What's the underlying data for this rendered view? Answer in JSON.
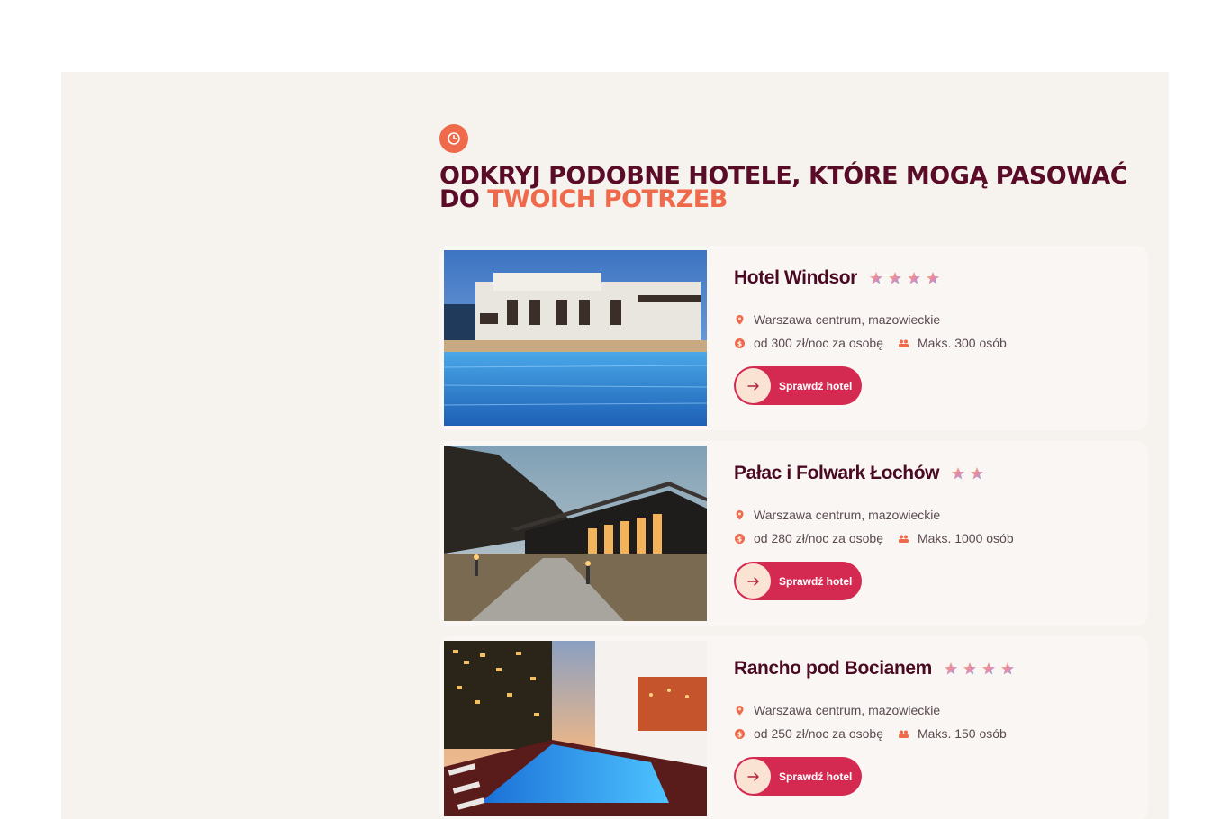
{
  "section": {
    "heading_main": "ODKRYJ PODOBNE HOTELE, KTÓRE MOGĄ PASOWAĆ DO ",
    "heading_accent": "TWOICH POTRZEB"
  },
  "colors": {
    "accent": "#ef6a4b",
    "heading": "#5a0b27",
    "button": "#d42a52",
    "background": "#f6f2ee"
  },
  "hotels": [
    {
      "name": "Hotel Windsor",
      "stars": 4,
      "location": "Warszawa centrum, mazowieckie",
      "price": "od 300 zł/noc za osobę",
      "capacity": "Maks. 300 osób",
      "button_label": "Sprawdź hotel"
    },
    {
      "name": "Pałac i Folwark Łochów",
      "stars": 2,
      "location": "Warszawa centrum, mazowieckie",
      "price": "od 280 zł/noc za osobę",
      "capacity": "Maks. 1000 osób",
      "button_label": "Sprawdź hotel"
    },
    {
      "name": "Rancho pod Bocianem",
      "stars": 4,
      "location": "Warszawa centrum, mazowieckie",
      "price": "od 250 zł/noc za osobę",
      "capacity": "Maks. 150 osób",
      "button_label": "Sprawdź hotel"
    }
  ],
  "icons": {
    "section_badge": "clock-icon",
    "location": "location-pin-icon",
    "price": "coin-icon",
    "capacity": "people-icon",
    "button": "arrow-right-icon",
    "rating": "star-icon"
  }
}
